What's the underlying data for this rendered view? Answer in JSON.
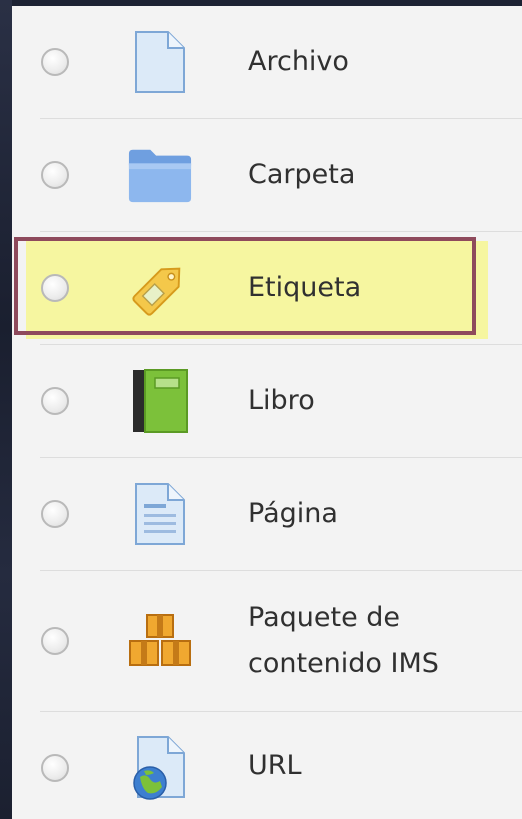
{
  "modules": [
    {
      "label": "Archivo",
      "icon": "file-icon",
      "selected": false
    },
    {
      "label": "Carpeta",
      "icon": "folder-icon",
      "selected": false
    },
    {
      "label": "Etiqueta",
      "icon": "tag-icon",
      "selected": true
    },
    {
      "label": "Libro",
      "icon": "book-icon",
      "selected": false
    },
    {
      "label": "Página",
      "icon": "page-icon",
      "selected": false
    },
    {
      "label_line1": "Paquete de",
      "label_line2": "contenido IMS",
      "icon": "ims-package-icon",
      "selected": false
    },
    {
      "label": "URL",
      "icon": "url-icon",
      "selected": false
    }
  ],
  "colors": {
    "highlight": "#f6f6a0",
    "selection_border": "#8e4a5c",
    "panel_bg": "#f3f3f3"
  }
}
